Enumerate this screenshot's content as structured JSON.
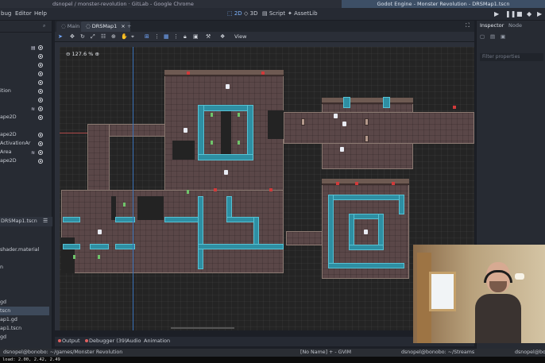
{
  "window": {
    "browser_title": "dsnopel / monster-revolution · GitLab - Google Chrome",
    "app_title": "Godot Engine - Monster Revolution - DRSMap1.tscn"
  },
  "menu": {
    "debug": "bug",
    "editor": "Editor",
    "help": "Help",
    "ws_2d": "2D",
    "ws_3d": "3D",
    "ws_script": "Script",
    "ws_assetlib": "AssetLib"
  },
  "scene_tree": {
    "rows": [
      "",
      "",
      "",
      "",
      "",
      "ition",
      "",
      "",
      "ape2D",
      "",
      "ape2D",
      "ActivationAr",
      "Area",
      "ape2D"
    ]
  },
  "filesystem": {
    "path": "DRSMap1.tscn",
    "rows": [
      "",
      "shader.material",
      "",
      "n",
      "",
      "gd",
      "tscn",
      "ap1.gd",
      "ap1.tscn",
      "gd",
      "tscn",
      "gd",
      "tscn"
    ]
  },
  "editor": {
    "tabs": [
      "Main",
      "DRSMap1"
    ],
    "view_menu": "View",
    "zoom": "127.6 %"
  },
  "bottom_panel": {
    "output": "Output",
    "debugger": "Debugger (39)",
    "audio": "Audio",
    "animation": "Animation"
  },
  "inspector": {
    "tab_inspector": "Inspector",
    "tab_node": "Node",
    "filter_placeholder": "Filter properties"
  },
  "taskbar": {
    "terminal_1": "dsnopel@bonobo: ~/games/Monster Revolution",
    "vim": "[No Name] + - GVIM",
    "terminal_2": "dsnopel@bonobo: ~/Streams",
    "terminal_3": "dsnopel@bo"
  },
  "status": {
    "load": "load: 2.00, 2.42, 2.49"
  },
  "colors": {
    "accent": "#73a8ff",
    "floor": "#5a4748",
    "water": "#2e8fa3",
    "marker_red": "#d23a3a"
  }
}
